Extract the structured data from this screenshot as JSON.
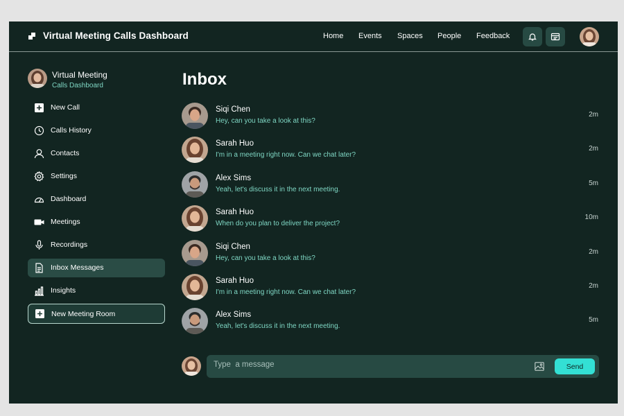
{
  "header": {
    "title": "Virtual Meeting Calls Dashboard",
    "nav": [
      "Home",
      "Events",
      "Spaces",
      "People",
      "Feedback"
    ],
    "icons": [
      "bell-icon",
      "layout-icon"
    ]
  },
  "profile": {
    "name": "Virtual Meeting",
    "subtitle": "Calls Dashboard"
  },
  "sidebar": {
    "items": [
      {
        "label": "New Call",
        "icon": "plus-square-icon"
      },
      {
        "label": "Calls History",
        "icon": "clock-icon"
      },
      {
        "label": "Contacts",
        "icon": "user-icon"
      },
      {
        "label": "Settings",
        "icon": "gear-icon"
      },
      {
        "label": "Dashboard",
        "icon": "gauge-icon"
      },
      {
        "label": "Meetings",
        "icon": "video-icon"
      },
      {
        "label": "Recordings",
        "icon": "microphone-icon"
      },
      {
        "label": "Inbox Messages",
        "icon": "document-icon",
        "active": true
      },
      {
        "label": "Insights",
        "icon": "bar-chart-icon"
      },
      {
        "label": "New Meeting Room",
        "icon": "plus-square-icon",
        "outlined": true
      }
    ]
  },
  "main": {
    "title": "Inbox",
    "messages": [
      {
        "name": "Siqi Chen",
        "text": "Hey, can you take a look at this?",
        "time": "2m"
      },
      {
        "name": "Sarah Huo",
        "text": "I'm in a meeting right now. Can we chat later?",
        "time": "2m"
      },
      {
        "name": "Alex Sims",
        "text": "Yeah, let's discuss it in the next meeting.",
        "time": "5m"
      },
      {
        "name": "Sarah Huo",
        "text": "When do you plan to deliver the project?",
        "time": "10m"
      },
      {
        "name": "Siqi Chen",
        "text": "Hey, can you take a look at this?",
        "time": "2m"
      },
      {
        "name": "Sarah Huo",
        "text": "I'm in a meeting right now. Can we chat later?",
        "time": "2m"
      },
      {
        "name": "Alex Sims",
        "text": "Yeah, let's discuss it in the next meeting.",
        "time": "5m"
      }
    ]
  },
  "composer": {
    "placeholder": "Type  a message",
    "send_label": "Send"
  },
  "colors": {
    "background": "#122521",
    "panel": "#274a43",
    "accent": "#33e0d4",
    "muted_text": "#7fd7c4"
  }
}
